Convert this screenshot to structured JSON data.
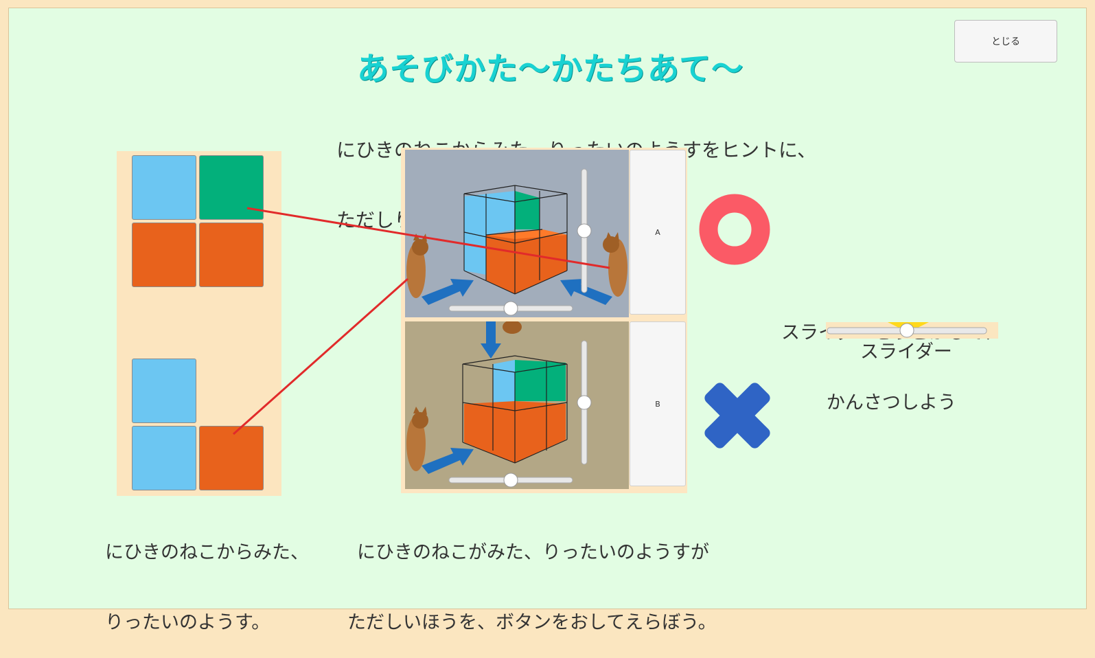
{
  "header": {
    "title": "あそびかた～かたちあて～",
    "close_label": "とじる"
  },
  "instructions": {
    "top_line1": "にひきのねこからみた、りったいのようすをヒントに、",
    "top_line2": "ただしりったいをえらぼう。",
    "left_line1": "にひきのねこからみた、",
    "left_line2": "りったいのようす。",
    "center_line1": "にひきのねこがみた、りったいのようすが",
    "center_line2": "ただしいほうを、ボタンをおしてえらぼう。",
    "right_line1": "スライダーをうごかして、",
    "right_line2": "かんさつしよう",
    "slider_label": "スライダー"
  },
  "choices": [
    {
      "label": "A",
      "result": "correct"
    },
    {
      "label": "B",
      "result": "incorrect"
    }
  ],
  "hint_tiles": {
    "top_view": [
      [
        "light-blue",
        "green"
      ],
      [
        "orange",
        "orange"
      ]
    ],
    "bottom_view": [
      [
        "light-blue",
        "empty"
      ],
      [
        "light-blue",
        "orange"
      ]
    ]
  },
  "sliders": {
    "demo_value": 0.5,
    "view_a_horizontal": 0.5,
    "view_a_vertical": 0.5,
    "view_b_horizontal": 0.5,
    "view_b_vertical": 0.5
  },
  "colors": {
    "light_blue": "#6cc6f2",
    "green": "#03b07b",
    "orange": "#e8621c",
    "title": "#19d2d2",
    "correct_mark": "#fb5a66",
    "wrong_mark": "#2f64c5",
    "arrow": "#1f70c0",
    "guide_line": "#e12a2a"
  }
}
